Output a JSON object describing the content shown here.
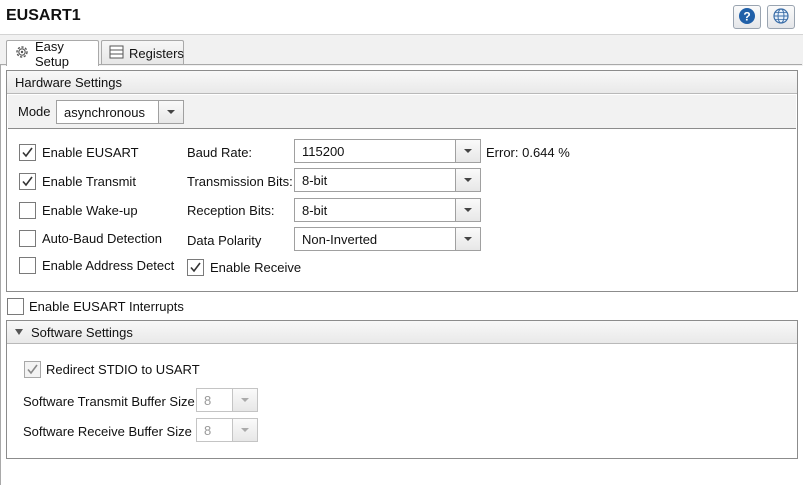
{
  "window": {
    "title": "EUSART1"
  },
  "header_icons": {
    "help": "help-icon",
    "globe": "globe-icon"
  },
  "tabs": [
    {
      "label": "Easy Setup",
      "icon": "gear-icon",
      "active": true
    },
    {
      "label": "Registers",
      "icon": "list-icon",
      "active": false
    }
  ],
  "hardware": {
    "title": "Hardware Settings",
    "mode_label": "Mode",
    "mode_value": "asynchronous",
    "checkboxes": [
      {
        "label": "Enable EUSART",
        "checked": true
      },
      {
        "label": "Enable Transmit",
        "checked": true
      },
      {
        "label": "Enable Wake-up",
        "checked": false
      },
      {
        "label": "Auto-Baud Detection",
        "checked": false
      },
      {
        "label": "Enable Address Detect",
        "checked": false
      }
    ],
    "baud_label": "Baud Rate:",
    "baud_value": "115200",
    "error_text": "Error: 0.644 %",
    "tx_bits_label": "Transmission Bits:",
    "tx_bits_value": "8-bit",
    "rx_bits_label": "Reception Bits:",
    "rx_bits_value": "8-bit",
    "polarity_label": "Data Polarity",
    "polarity_value": "Non-Inverted",
    "enable_receive": {
      "label": "Enable Receive",
      "checked": true
    }
  },
  "interrupts": {
    "label": "Enable EUSART Interrupts",
    "checked": false
  },
  "software": {
    "title": "Software Settings",
    "redirect": {
      "label": "Redirect STDIO to USART",
      "checked": true
    },
    "tx_buffer_label": "Software Transmit Buffer Size",
    "tx_buffer_value": "8",
    "rx_buffer_label": "Software Receive Buffer Size",
    "rx_buffer_value": "8"
  },
  "colors": {
    "help_blue": "#1f5fa8",
    "panel_border": "#8c8c8c",
    "header_bg": "#eeeeee"
  }
}
